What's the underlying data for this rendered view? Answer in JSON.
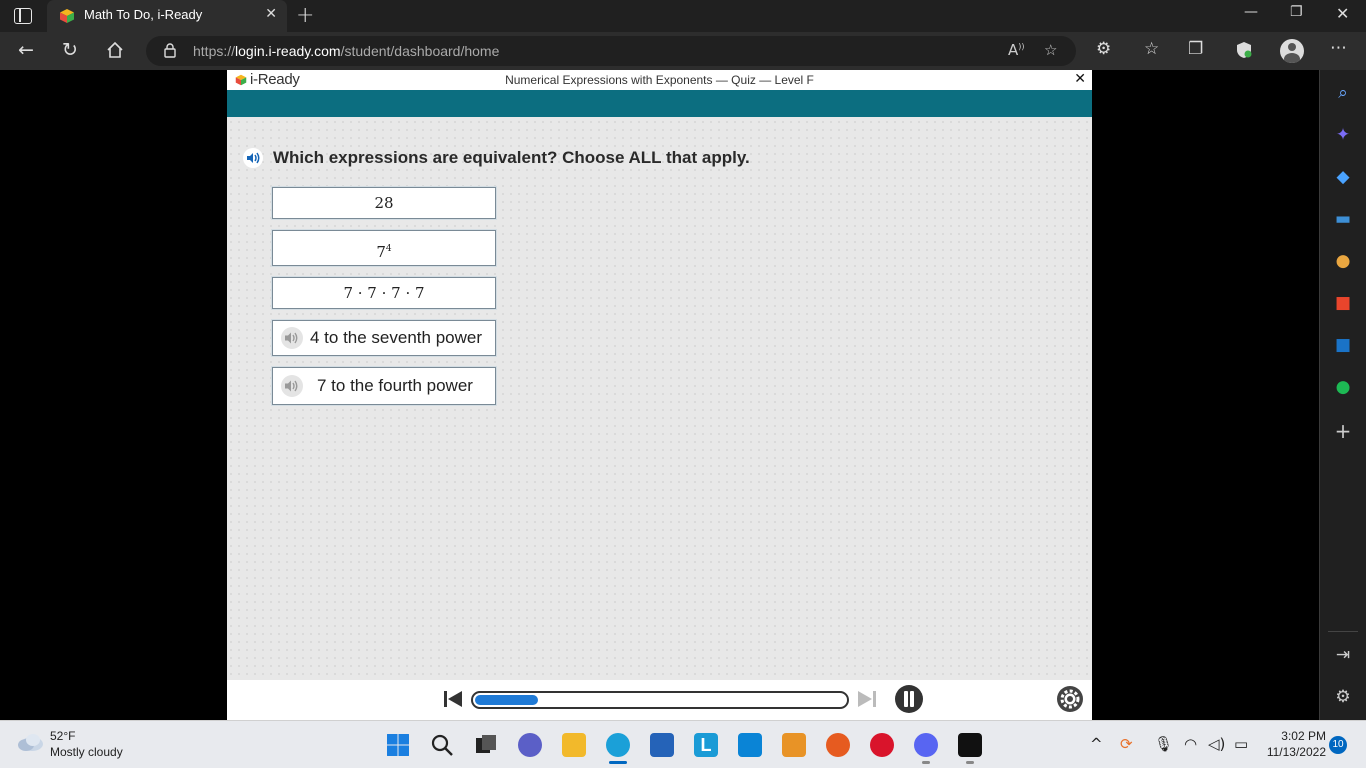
{
  "browser": {
    "tab_title": "Math To Do, i-Ready",
    "new_tab_glyph": "+",
    "tab_close_glyph": "✕",
    "url_prefix": "https://",
    "url_host": "login.i-ready.com",
    "url_path": "/student/dashboard/home",
    "window_controls": {
      "minimize": "—",
      "restore": "❐",
      "close": "✕"
    }
  },
  "app": {
    "brand": "i-Ready",
    "quiz_title": "Numerical Expressions with Exponents — Quiz — Level F",
    "close_glyph": "✕",
    "header_band_color": "#0c6e80",
    "question": "Which expressions are equivalent? Choose ALL that apply.",
    "choices": [
      {
        "text": "28"
      },
      {
        "base": "7",
        "exponent": "4"
      },
      {
        "text": "7 · 7 · 7 · 7"
      },
      {
        "text": "4 to the seventh power"
      },
      {
        "text": "7 to the fourth power"
      }
    ],
    "progress_fraction": 0.17,
    "accent_color": "#1f7ad6"
  },
  "taskbar": {
    "weather_temp": "52°F",
    "weather_desc": "Mostly cloudy",
    "time": "3:02 PM",
    "date": "11/13/2022",
    "notification_count": "10"
  }
}
